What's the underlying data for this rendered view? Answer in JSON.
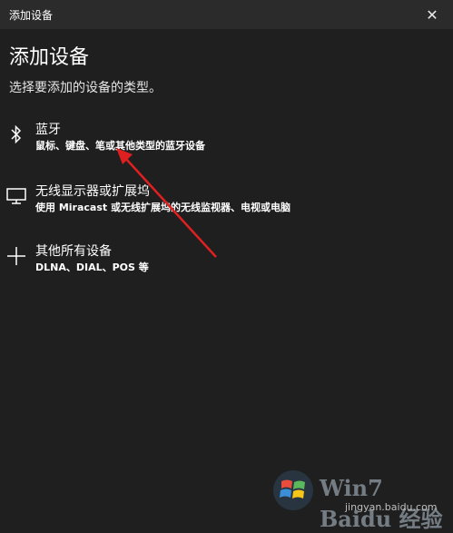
{
  "window": {
    "title": "添加设备"
  },
  "page": {
    "heading": "添加设备",
    "subtitle": "选择要添加的设备的类型。"
  },
  "options": [
    {
      "label": "蓝牙",
      "description": "鼠标、键盘、笔或其他类型的蓝牙设备",
      "icon": "bluetooth-icon"
    },
    {
      "label": "无线显示器或扩展坞",
      "description": "使用 Miracast 或无线扩展坞的无线监视器、电视或电脑",
      "icon": "monitor-icon"
    },
    {
      "label": "其他所有设备",
      "description": "DLNA、DIAL、POS 等",
      "icon": "plus-icon"
    }
  ],
  "annotation": {
    "arrow_color": "#e02020"
  },
  "watermark": {
    "text": "Win7 Baidu 经验",
    "url": "jingyan.baidu.com"
  },
  "colors": {
    "background": "#1f1f1f",
    "titlebar": "#2b2b2b",
    "text": "#ffffff"
  }
}
